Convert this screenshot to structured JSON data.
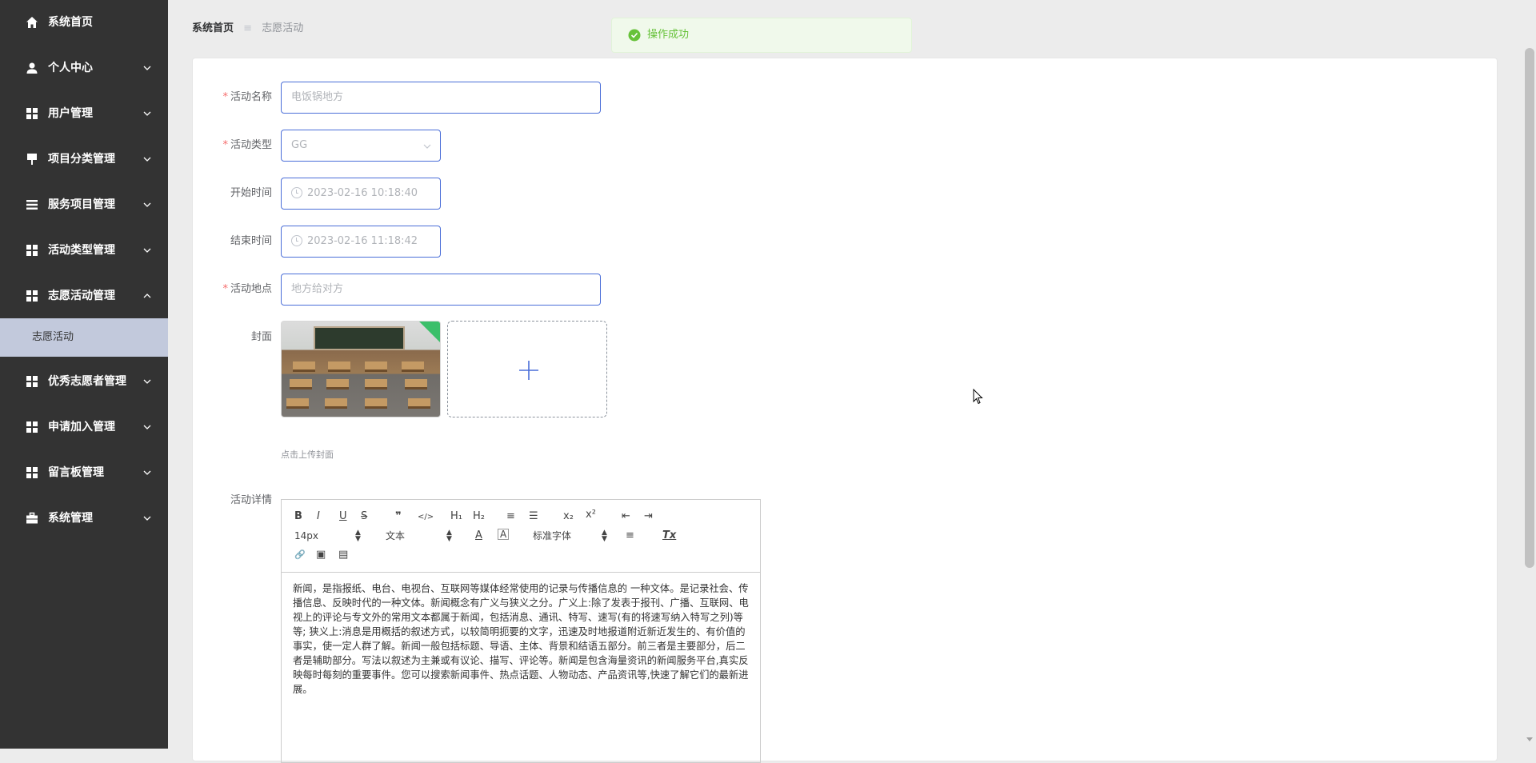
{
  "sidebar": {
    "items": [
      {
        "label": "系统首页",
        "icon": "home-icon"
      },
      {
        "label": "个人中心",
        "icon": "user-icon"
      },
      {
        "label": "用户管理",
        "icon": "grid-icon"
      },
      {
        "label": "项目分类管理",
        "icon": "sign-icon"
      },
      {
        "label": "服务项目管理",
        "icon": "list-icon"
      },
      {
        "label": "活动类型管理",
        "icon": "grid-icon"
      },
      {
        "label": "志愿活动管理",
        "icon": "grid-icon"
      },
      {
        "label": "优秀志愿者管理",
        "icon": "grid-icon"
      },
      {
        "label": "申请加入管理",
        "icon": "grid-icon"
      },
      {
        "label": "留言板管理",
        "icon": "grid-icon"
      },
      {
        "label": "系统管理",
        "icon": "briefcase-icon"
      }
    ],
    "active_sub": "志愿活动"
  },
  "breadcrumb": {
    "home": "系统首页",
    "separator": "≡",
    "current": "志愿活动"
  },
  "toast": {
    "text": "操作成功"
  },
  "form": {
    "name": {
      "label": "活动名称",
      "value": "电饭锅地方"
    },
    "type": {
      "label": "活动类型",
      "value": "GG"
    },
    "start": {
      "label": "开始时间",
      "value": "2023-02-16 10:18:40"
    },
    "end": {
      "label": "结束时间",
      "value": "2023-02-16 11:18:42"
    },
    "location": {
      "label": "活动地点",
      "value": "地方给对方"
    },
    "cover": {
      "label": "封面",
      "tip": "点击上传封面"
    },
    "detail": {
      "label": "活动详情"
    }
  },
  "editor": {
    "toolbar": {
      "bold": "B",
      "italic": "I",
      "underline": "U",
      "strike": "S",
      "quote": "❞",
      "code": "</>",
      "h1": "H₁",
      "h2": "H₂",
      "ordered": "≡",
      "bullet": "☰",
      "sub": "x₂",
      "sup": "x²",
      "outdent": "⇤",
      "indent": "⇥",
      "size": "14px",
      "header": "文本",
      "color": "A",
      "bg": "A",
      "font": "标准字体",
      "align": "≡",
      "clean": "Tx",
      "link": "🔗",
      "image": "▣",
      "video": "▤"
    },
    "content": "新闻，是指报纸、电台、电视台、互联网等媒体经常使用的记录与传播信息的 一种文体。是记录社会、传播信息、反映时代的一种文体。新闻概念有广义与狭义之分。广义上:除了发表于报刊、广播、互联网、电视上的评论与专文外的常用文本都属于新闻，包括消息、通讯、特写、速写(有的将速写纳入特写之列)等等; 狭义上:消息是用概括的叙述方式，以较简明扼要的文字，迅速及时地报道附近新近发生的、有价值的事实，使一定人群了解。新闻一般包括标题、导语、主体、背景和结语五部分。前三者是主要部分，后二者是辅助部分。写法以叙述为主兼或有议论、描写、评论等。新闻是包含海量资讯的新闻服务平台,真实反映每时每刻的重要事件。您可以搜索新闻事件、热点话题、人物动态、产品资讯等,快速了解它们的最新进展。"
  },
  "colors": {
    "sidebar_bg": "#333333",
    "accent": "#4a6ed8",
    "success": "#67c23a",
    "required": "#f56c6c"
  }
}
